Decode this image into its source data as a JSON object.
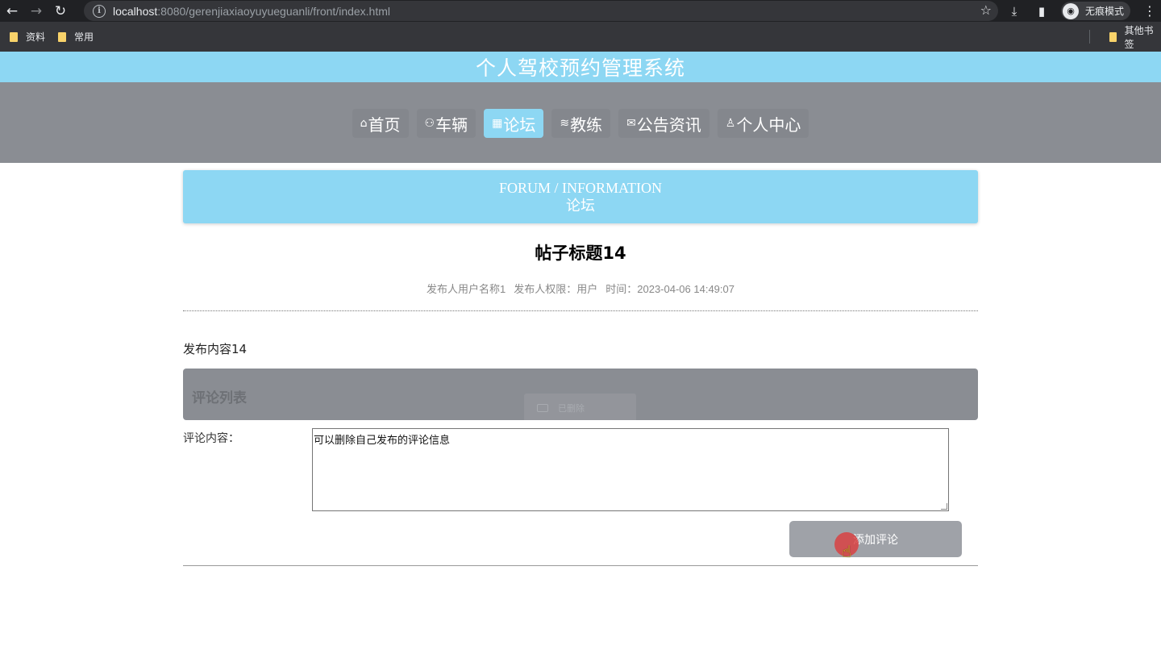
{
  "browser": {
    "back": "←",
    "forward": "→",
    "reload": "↻",
    "url_host": "localhost",
    "url_rest": ":8080/gerenjiaxiaoyuyueguanli/front/index.html",
    "star": "☆",
    "download": "⤓",
    "sidepanel": "▮",
    "incognito_label": "无痕模式",
    "incognito_icon": "◉",
    "menu": "⋮"
  },
  "bookmarks": {
    "items": [
      {
        "label": "资料"
      },
      {
        "label": "常用"
      }
    ],
    "right": "其他书签"
  },
  "site": {
    "title": "个人驾校预约管理系统",
    "accent": "#8dd7f3",
    "nav_bg": "#8a8d93"
  },
  "nav": {
    "items": [
      {
        "icon": "⌂",
        "label": "首页"
      },
      {
        "icon": "⚇",
        "label": "车辆"
      },
      {
        "icon": "▦",
        "label": "论坛"
      },
      {
        "icon": "≋",
        "label": "教练"
      },
      {
        "icon": "✉",
        "label": "公告资讯"
      },
      {
        "icon": "♙",
        "label": "个人中心"
      }
    ],
    "active_index": 2
  },
  "banner": {
    "en": "FORUM / INFORMATION",
    "cn": "论坛"
  },
  "post": {
    "title": "帖子标题14",
    "author": "发布人用户名称1",
    "role": "发布人权限：用户",
    "time": "时间：2023-04-06 14:49:07",
    "content": "发布内容14"
  },
  "comments": {
    "header": "评论列表",
    "toast": "已删除",
    "label": "评论内容：",
    "value": "可以删除自己发布的评论信息",
    "submit": "添加评论"
  }
}
